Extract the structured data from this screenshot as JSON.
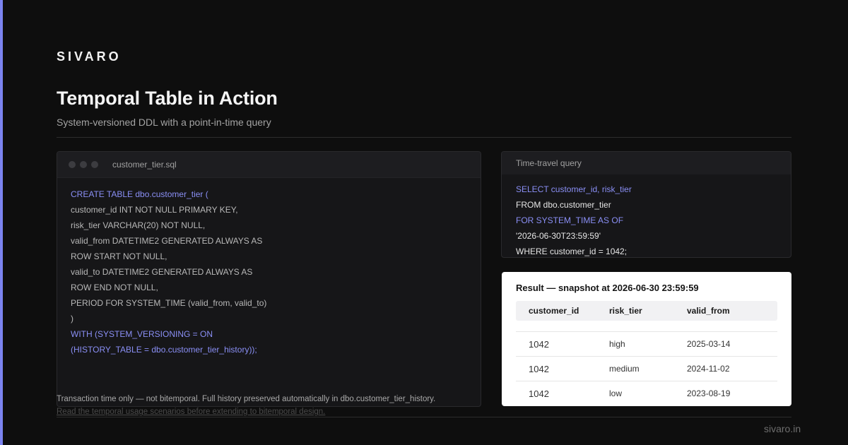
{
  "brand": "SIVARO",
  "title": "Temporal Table in Action",
  "subtitle": "System-versioned DDL with a point-in-time query",
  "editor": {
    "filename": "customer_tier.sql",
    "lines": [
      "CREATE TABLE dbo.customer_tier (",
      "customer_id INT NOT NULL PRIMARY KEY,",
      "risk_tier VARCHAR(20) NOT NULL,",
      "valid_from DATETIME2 GENERATED ALWAYS AS",
      "ROW START NOT NULL,",
      "valid_to DATETIME2 GENERATED ALWAYS AS",
      "ROW END NOT NULL,",
      "PERIOD FOR SYSTEM_TIME (valid_from, valid_to)",
      ")",
      "WITH (SYSTEM_VERSIONING = ON",
      "(HISTORY_TABLE = dbo.customer_tier_history));"
    ]
  },
  "query": {
    "heading": "Time-travel query",
    "lines": [
      "SELECT customer_id, risk_tier",
      "FROM dbo.customer_tier",
      "FOR SYSTEM_TIME AS OF",
      "'2026-06-30T23:59:59'",
      "WHERE customer_id = 1042;"
    ]
  },
  "result": {
    "title": "Result — snapshot at 2026-06-30 23:59:59",
    "columns": [
      "customer_id",
      "risk_tier",
      "valid_from"
    ],
    "rows": [
      [
        "1042",
        "high",
        "2025-03-14"
      ],
      [
        "1042",
        "medium",
        "2024-11-02"
      ],
      [
        "1042",
        "low",
        "2023-08-19"
      ]
    ]
  },
  "note": "Transaction time only — not bitemporal. Full history preserved automatically in dbo.customer_tier_history.",
  "link": "Read the temporal usage scenarios before extending to bitemporal design.",
  "footer_url": "sivaro.in",
  "colors": {
    "accent": "#7b83f0",
    "keyword": "#8a8ff5",
    "background": "#0e0e0e"
  }
}
